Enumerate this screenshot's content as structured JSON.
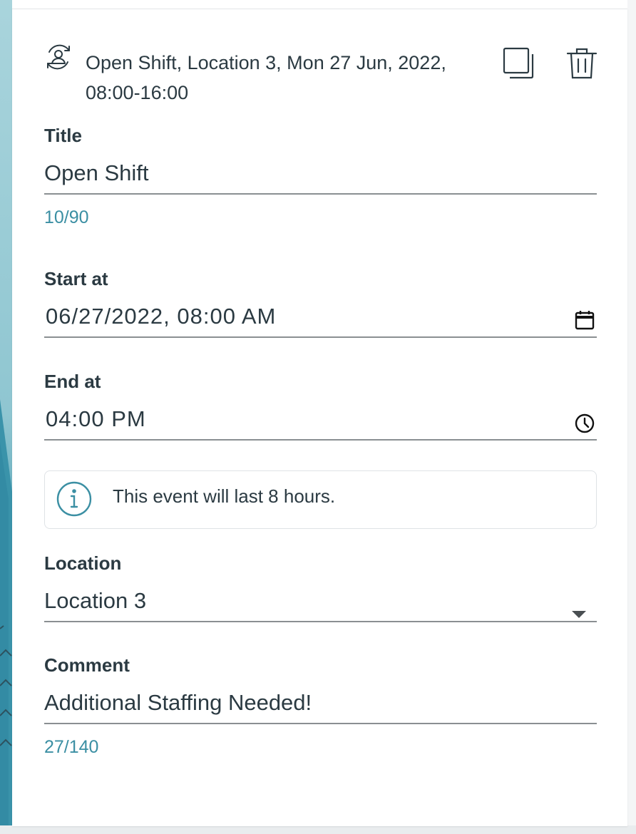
{
  "header": {
    "summary": "Open Shift, Location 3, Mon 27 Jun, 2022, 08:00-16:00",
    "shift_icon": "shift-swap-icon",
    "copy_icon": "copy-icon",
    "delete_icon": "trash-icon"
  },
  "form": {
    "title": {
      "label": "Title",
      "value": "Open Shift",
      "counter": "10/90"
    },
    "start": {
      "label": "Start at",
      "value": "06/27/2022, 08:00 AM",
      "icon": "calendar-icon"
    },
    "end": {
      "label": "End at",
      "value": "04:00 PM",
      "icon": "clock-icon"
    },
    "info": {
      "icon": "info-icon",
      "text": "This event will last 8 hours."
    },
    "location": {
      "label": "Location",
      "value": "Location 3",
      "icon": "caret-down-icon"
    },
    "comment": {
      "label": "Comment",
      "value": "Additional Staffing Needed!",
      "counter": "27/140"
    }
  },
  "colors": {
    "text": "#2b3a42",
    "accent": "#3b8fa3",
    "underline": "#8a8f92"
  }
}
